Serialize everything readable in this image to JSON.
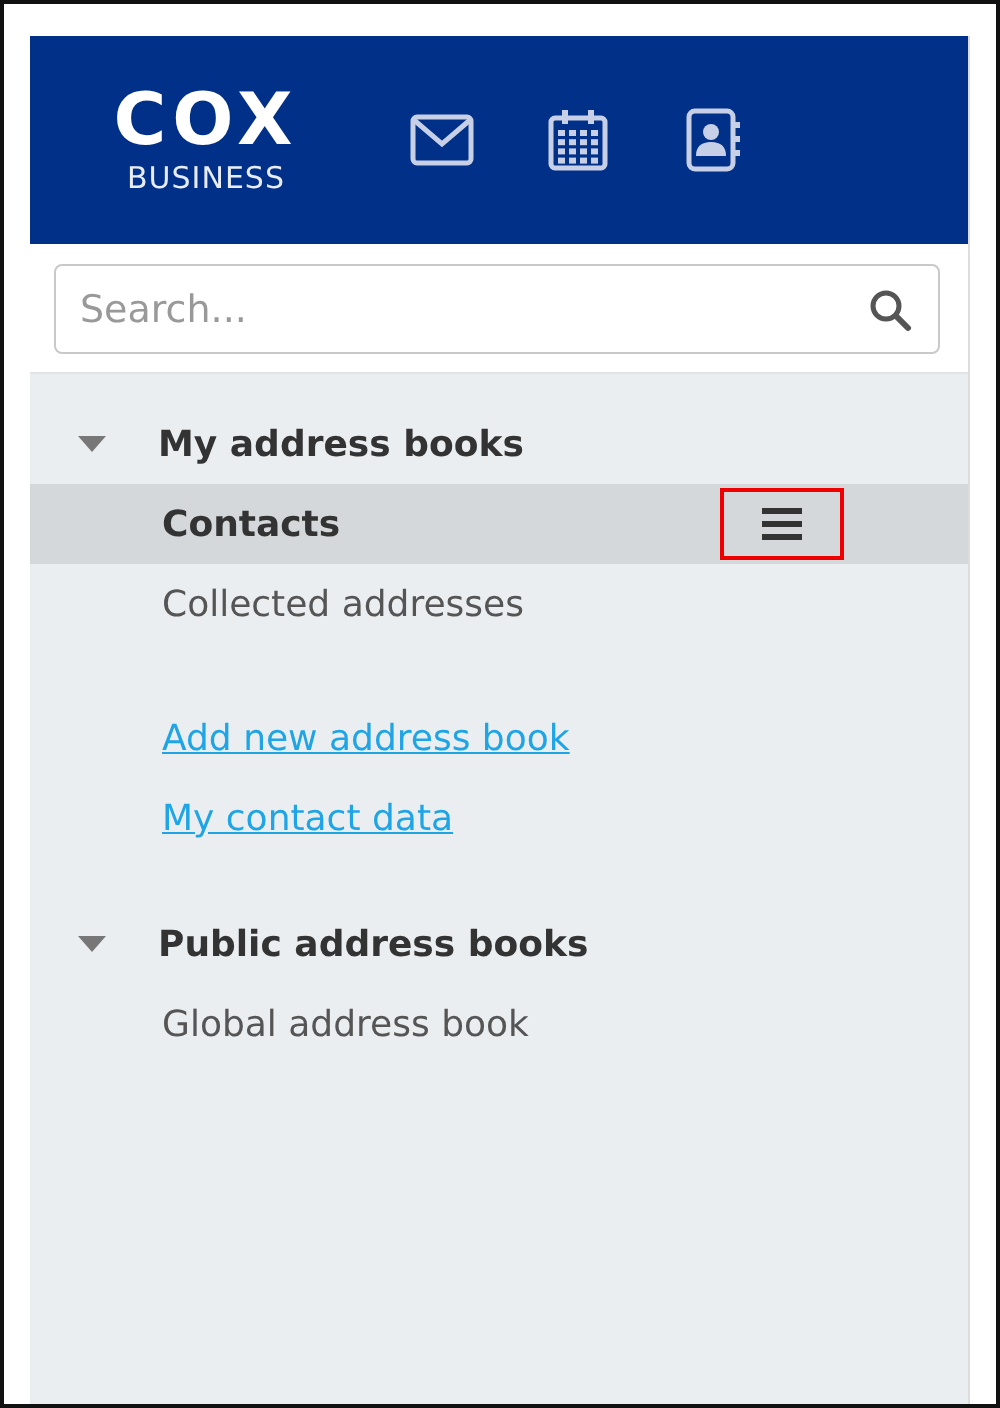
{
  "logo": {
    "line1": "COX",
    "line2": "BUSINESS"
  },
  "nav": [
    {
      "kind": "mail"
    },
    {
      "kind": "calendar"
    },
    {
      "kind": "contacts"
    }
  ],
  "search": {
    "placeholder": "Search..."
  },
  "sections": [
    {
      "kind": "group",
      "title": "My address books",
      "expanded": true,
      "children": [
        {
          "label": "Contacts",
          "selected": true,
          "menu": {
            "highlighted": true
          }
        },
        {
          "label": "Collected addresses",
          "selected": false
        }
      ]
    },
    {
      "kind": "links",
      "items": [
        "Add new address book",
        "My contact data"
      ]
    },
    {
      "kind": "group",
      "title": "Public address books",
      "expanded": true,
      "children": [
        {
          "label": "Global address book",
          "selected": false
        }
      ]
    }
  ]
}
